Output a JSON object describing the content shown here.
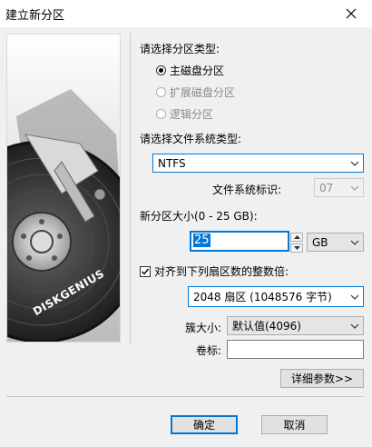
{
  "window": {
    "title": "建立新分区"
  },
  "partition_type": {
    "label": "请选择分区类型:",
    "options": [
      {
        "label": "主磁盘分区",
        "selected": true,
        "enabled": true
      },
      {
        "label": "扩展磁盘分区",
        "selected": false,
        "enabled": false
      },
      {
        "label": "逻辑分区",
        "selected": false,
        "enabled": false
      }
    ]
  },
  "filesystem": {
    "label": "请选择文件系统类型:",
    "value": "NTFS",
    "id_label": "文件系统标识:",
    "id_value": "07"
  },
  "size": {
    "label": "新分区大小(0 - 25 GB):",
    "value": "25",
    "unit": "GB"
  },
  "alignment": {
    "checkbox_label": "对齐到下列扇区数的整数倍:",
    "checked": true,
    "value": "2048 扇区 (1048576 字节)"
  },
  "cluster": {
    "label": "簇大小:",
    "value": "默认值(4096)"
  },
  "volume": {
    "label": "卷标:",
    "value": ""
  },
  "buttons": {
    "details": "详细参数>>",
    "ok": "确定",
    "cancel": "取消"
  },
  "brand": {
    "text": "DISKGENIUS"
  },
  "colors": {
    "accent": "#0078d7",
    "background": "#f0f0f0"
  }
}
